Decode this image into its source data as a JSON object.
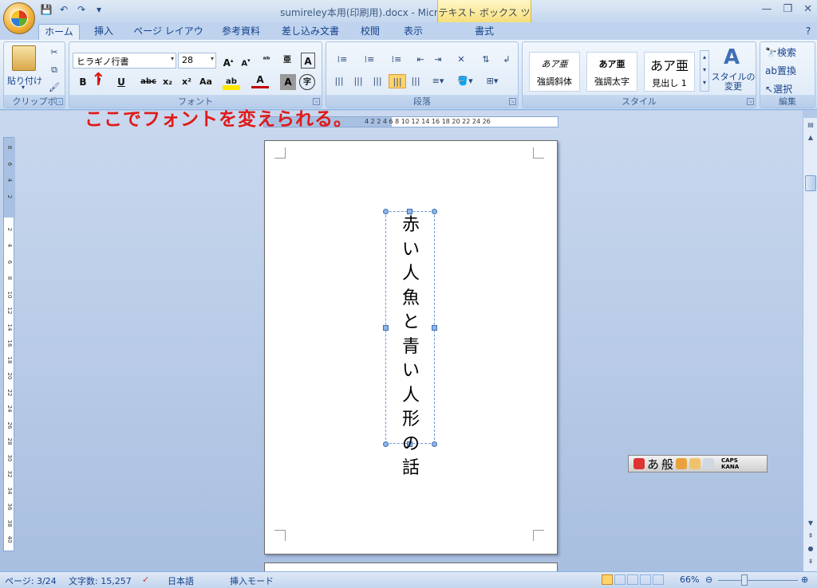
{
  "window": {
    "title": "sumireley本用(印刷用).docx - Microsoft Word",
    "context_tab": "テキスト ボックス ツール"
  },
  "tabs": [
    "ホーム",
    "挿入",
    "ページ レイアウト",
    "参考資料",
    "差し込み文書",
    "校閲",
    "表示",
    "書式"
  ],
  "ribbon": {
    "clipboard": {
      "paste_label": "貼り付け",
      "group_label": "クリップボー..."
    },
    "font": {
      "font_name": "ヒラギノ行書",
      "font_size": "28",
      "group_label": "フォント"
    },
    "paragraph": {
      "group_label": "段落"
    },
    "styles": {
      "items": [
        {
          "sample": "あア亜",
          "label": "強調斜体"
        },
        {
          "sample": "あア亜",
          "label": "強調太字"
        },
        {
          "sample": "あア亜",
          "label": "見出し 1"
        }
      ],
      "change_label": "スタイルの変更",
      "group_label": "スタイル"
    },
    "editing": {
      "find": "検索",
      "replace": "置換",
      "select": "選択",
      "group_label": "編集"
    }
  },
  "annotation": {
    "text": "ここでフォントを変えられる。",
    "arrow": "↑"
  },
  "document": {
    "vertical_text": [
      "赤",
      "い",
      "人",
      "魚",
      "と",
      "青",
      "い",
      "人",
      "形",
      "の",
      "話"
    ]
  },
  "ruler": {
    "horizontal_ticks": "4   2        2   4   6   8  10  12  14  16  18  20  22  24  26",
    "vertical_ticks": [
      "8",
      "6",
      "4",
      "2",
      "",
      "2",
      "4",
      "6",
      "8",
      "10",
      "12",
      "14",
      "16",
      "18",
      "20",
      "22",
      "24",
      "26",
      "28",
      "30",
      "32",
      "34",
      "36",
      "38",
      "40"
    ]
  },
  "ime": {
    "mode": "あ",
    "dict": "般",
    "caps": "CAPS",
    "kana": "KANA"
  },
  "status": {
    "page": "ページ: 3/24",
    "word_count": "文字数: 15,257",
    "language": "日本語",
    "mode": "挿入モード",
    "zoom": "66%"
  },
  "colors": {
    "annotation": "#e01919",
    "ribbon": "#dde9f7"
  }
}
